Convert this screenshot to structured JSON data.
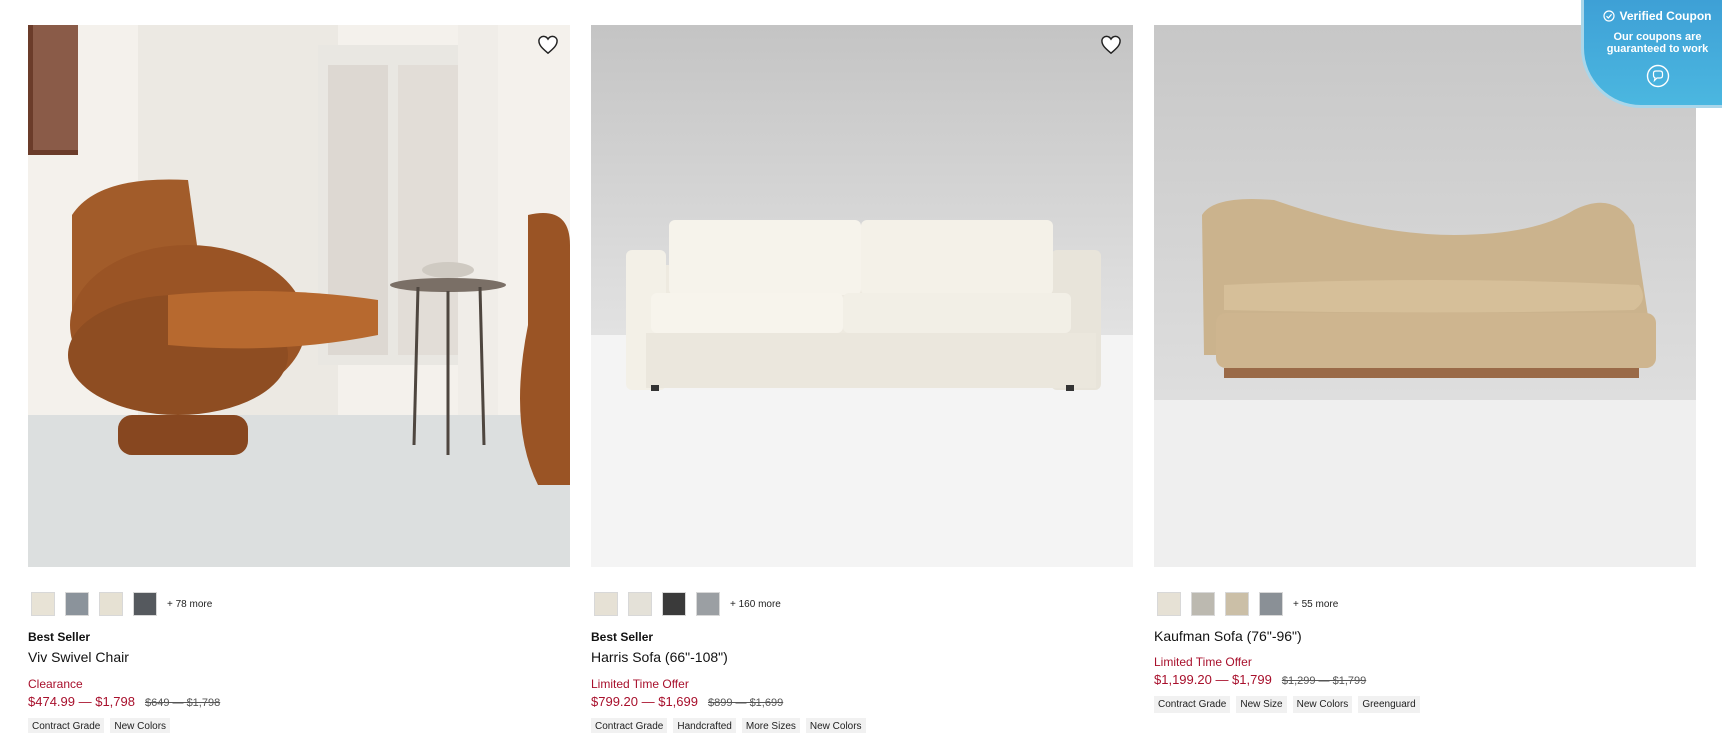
{
  "products": [
    {
      "badge": "Best Seller",
      "name": "Viv Swivel Chair",
      "promo": "Clearance",
      "price": "$474.99 — $1,798",
      "was": "$649 — $1,798",
      "more": "+ 78 more",
      "swatches": [
        "#e8e3d6",
        "#8b939b",
        "#e6e1d3",
        "#55595e"
      ],
      "tags": [
        "Contract Grade",
        "New Colors"
      ],
      "image": "chair-photo"
    },
    {
      "badge": "Best Seller",
      "name": "Harris Sofa (66\"-108\")",
      "promo": "Limited Time Offer",
      "price": "$799.20 — $1,699",
      "was": "$899 — $1,699",
      "more": "+ 160 more",
      "swatches": [
        "#e6e1d5",
        "#e4e1d8",
        "#3a3a3a",
        "#9b9fa3"
      ],
      "tags": [
        "Contract Grade",
        "Handcrafted",
        "More Sizes",
        "New Colors"
      ],
      "image": "sofa-photo"
    },
    {
      "badge": "",
      "name": "Kaufman Sofa (76\"-96\")",
      "promo": "Limited Time Offer",
      "price": "$1,199.20 — $1,799",
      "was": "$1,299 — $1,799",
      "more": "+ 55 more",
      "swatches": [
        "#e6e1d5",
        "#bcb9b0",
        "#cbbfa7",
        "#8a9096"
      ],
      "tags": [
        "Contract Grade",
        "New Size",
        "New Colors",
        "Greenguard"
      ],
      "image": "curved-sofa-photo"
    }
  ],
  "coupon": {
    "title": "Verified Coupon",
    "subtitle_line1": "Our coupons are",
    "subtitle_line2": "guaranteed to work",
    "icon": "chat-icon"
  },
  "colors": {
    "accent": "#a8102c",
    "coupon": "#3ea0d6"
  }
}
